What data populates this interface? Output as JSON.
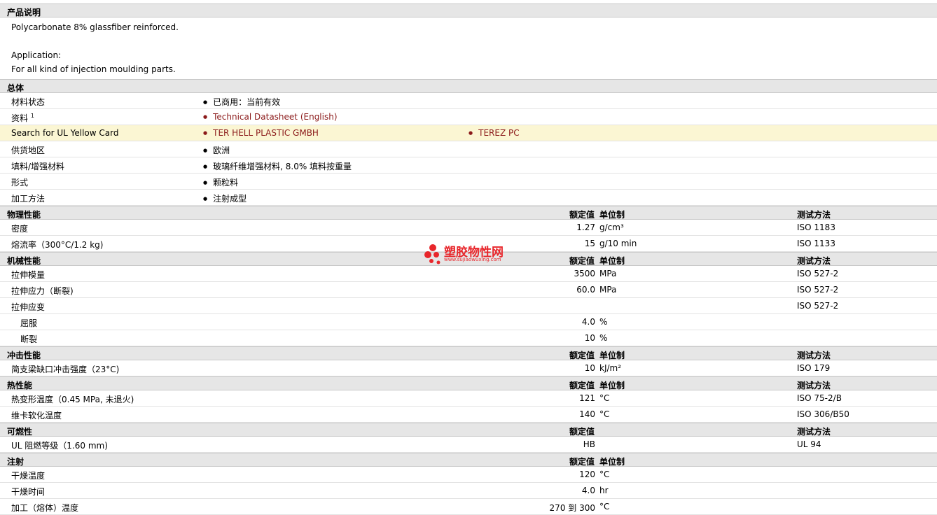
{
  "product_description": {
    "title": "产品说明",
    "line1": "Polycarbonate 8% glassfiber reinforced.",
    "line2": "Application:",
    "line3": "For all kind of injection moulding parts."
  },
  "general": {
    "title": "总体",
    "rows": [
      {
        "label": "材料状态",
        "v1": "已商用：当前有效"
      },
      {
        "label": "资料",
        "sup": "1",
        "v1": "Technical Datasheet (English)"
      },
      {
        "label": "Search for UL Yellow Card",
        "v1": "TER HELL PLASTIC GMBH",
        "v2": "TEREZ PC"
      },
      {
        "label": "供货地区",
        "v1": "欧洲"
      },
      {
        "label": "填料/增强材料",
        "v1": "玻璃纤维增强材料, 8.0% 填料按重量"
      },
      {
        "label": "形式",
        "v1": "颗粒料"
      },
      {
        "label": "加工方法",
        "v1": "注射成型"
      }
    ]
  },
  "columns": {
    "nominal": "额定值",
    "unit": "单位制",
    "test": "测试方法"
  },
  "physical": {
    "title": "物理性能",
    "rows": [
      {
        "label": "密度",
        "val": "1.27",
        "unit": "g/cm³",
        "test": "ISO 1183"
      },
      {
        "label": "熔流率（300°C/1.2 kg)",
        "val": "15",
        "unit": "g/10 min",
        "test": "ISO 1133"
      }
    ]
  },
  "mechanical": {
    "title": "机械性能",
    "rows": [
      {
        "label": "拉伸模量",
        "val": "3500",
        "unit": "MPa",
        "test": "ISO 527-2"
      },
      {
        "label": "拉伸应力（断裂)",
        "val": "60.0",
        "unit": "MPa",
        "test": "ISO 527-2"
      },
      {
        "label": "拉伸应变",
        "val": "",
        "unit": "",
        "test": "ISO 527-2"
      },
      {
        "label": "屈服",
        "val": "4.0",
        "unit": "%",
        "test": ""
      },
      {
        "label": "断裂",
        "val": "10",
        "unit": "%",
        "test": ""
      }
    ]
  },
  "impact": {
    "title": "冲击性能",
    "rows": [
      {
        "label": "简支梁缺口冲击强度（23°C)",
        "val": "10",
        "unit": "kJ/m²",
        "test": "ISO 179"
      }
    ]
  },
  "thermal": {
    "title": "热性能",
    "rows": [
      {
        "label": "热变形温度（0.45 MPa, 未退火)",
        "val": "121",
        "unit": "°C",
        "test": "ISO 75-2/B"
      },
      {
        "label": "维卡软化温度",
        "val": "140",
        "unit": "°C",
        "test": "ISO 306/B50"
      }
    ]
  },
  "flammability": {
    "title": "可燃性",
    "rows": [
      {
        "label": "UL 阻燃等级（1.60 mm)",
        "val": "HB",
        "unit": "",
        "test": "UL 94"
      }
    ]
  },
  "injection": {
    "title": "注射",
    "rows": [
      {
        "label": "干燥温度",
        "val": "120",
        "unit": "°C",
        "test": ""
      },
      {
        "label": "干燥时间",
        "val": "4.0",
        "unit": "hr",
        "test": ""
      },
      {
        "label": "加工（熔体）温度",
        "val": "270 到  300",
        "unit": "°C",
        "test": ""
      }
    ]
  },
  "watermark": {
    "text": "塑胶物性网",
    "url": "www.sujiaowuxing.com",
    "color": "#e8262b"
  }
}
